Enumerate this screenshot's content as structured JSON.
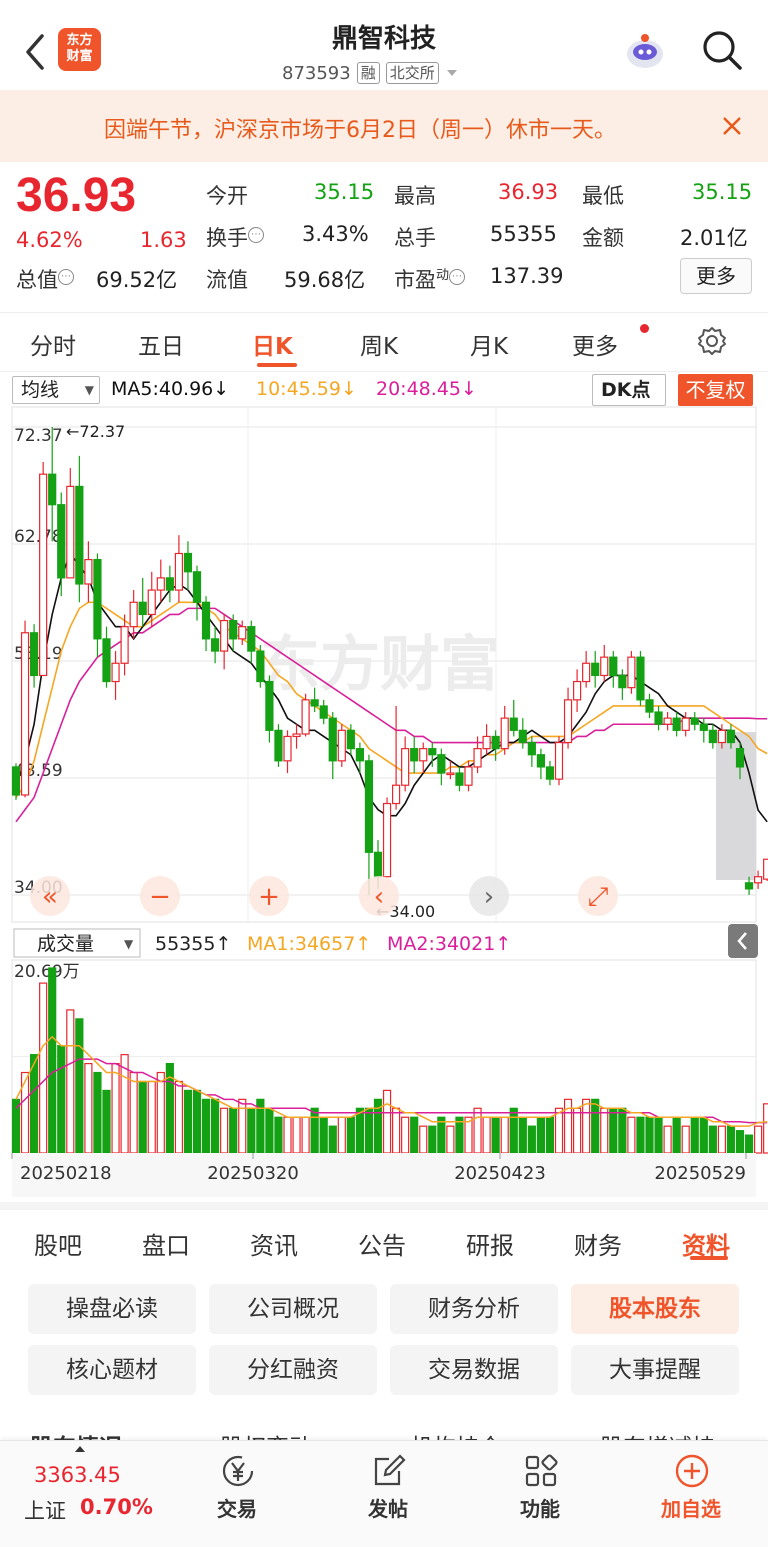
{
  "header": {
    "title": "鼎智科技",
    "code": "873593",
    "tags": [
      "融",
      "北交所"
    ],
    "logo_lines": [
      "东方",
      "财富"
    ]
  },
  "notice": {
    "text": "因端午节，沪深京市场于6月2日（周一）休市一天。"
  },
  "quote": {
    "price": "36.93",
    "change_pct": "4.62%",
    "change": "1.63",
    "open_label": "今开",
    "open": "35.15",
    "high_label": "最高",
    "high": "36.93",
    "low_label": "最低",
    "low": "35.15",
    "turnover_label": "换手",
    "turnover": "3.43%",
    "volume_label": "总手",
    "volume": "55355",
    "amount_label": "金额",
    "amount": "2.01亿",
    "mktcap_label": "总值",
    "mktcap": "69.52亿",
    "float_label": "流值",
    "float_cap": "59.68亿",
    "pe_label": "市盈",
    "pe_sup": "动",
    "pe": "137.39",
    "more": "更多"
  },
  "period_tabs": {
    "items": [
      "分时",
      "五日",
      "日K",
      "周K",
      "月K",
      "更多"
    ],
    "active": "日K"
  },
  "ma": {
    "selector": "均线",
    "ma5": "MA5:40.96↓",
    "ma10": "10:45.59↓",
    "ma20": "20:48.45↓",
    "dk": "DK点",
    "adjust": "不复权"
  },
  "vol": {
    "selector": "成交量",
    "value": "55355↑",
    "ma1": "MA1:34657↑",
    "ma2": "MA2:34021↑",
    "max_label": "20.69万"
  },
  "chart_data": {
    "type": "candlestick",
    "y_ticks": [
      "72.37",
      "62.78",
      "53.19",
      "43.59",
      "34.00"
    ],
    "ylim": [
      34.0,
      72.37
    ],
    "high_marker": "←72.37",
    "low_marker": "←34.00",
    "x_ticks": [
      "20250218",
      "20250320",
      "20250423",
      "20250529"
    ],
    "colors": {
      "up": "#e8262f",
      "down": "#14a114",
      "ma5": "#111111",
      "ma10": "#f5a623",
      "ma20": "#d91f9a"
    },
    "candles": [
      [
        44.5,
        42.2,
        44.8,
        41.8
      ],
      [
        42.2,
        55.5,
        56.5,
        42.0
      ],
      [
        55.5,
        52.0,
        56.2,
        51.0
      ],
      [
        52.0,
        68.5,
        69.5,
        52.0
      ],
      [
        68.5,
        66.0,
        72.37,
        63.0
      ],
      [
        66.0,
        60.0,
        67.0,
        58.5
      ],
      [
        60.0,
        67.5,
        69.0,
        60.0
      ],
      [
        67.5,
        59.5,
        70.0,
        58.0
      ],
      [
        59.5,
        61.5,
        63.0,
        58.0
      ],
      [
        61.5,
        55.0,
        62.0,
        53.5
      ],
      [
        55.0,
        51.5,
        56.0,
        51.0
      ],
      [
        51.5,
        53.0,
        54.0,
        50.0
      ],
      [
        53.0,
        56.0,
        57.0,
        52.0
      ],
      [
        56.0,
        58.0,
        59.0,
        55.0
      ],
      [
        58.0,
        57.0,
        60.0,
        56.0
      ],
      [
        57.0,
        59.0,
        60.5,
        56.0
      ],
      [
        59.0,
        60.0,
        61.5,
        58.0
      ],
      [
        60.0,
        59.0,
        61.0,
        58.0
      ],
      [
        59.0,
        62.0,
        63.5,
        58.0
      ],
      [
        62.0,
        60.5,
        63.0,
        59.0
      ],
      [
        60.5,
        58.0,
        61.0,
        56.5
      ],
      [
        58.0,
        55.0,
        58.5,
        54.0
      ],
      [
        55.0,
        54.0,
        56.0,
        53.0
      ],
      [
        54.0,
        56.5,
        57.0,
        52.5
      ],
      [
        56.5,
        55.0,
        57.0,
        54.0
      ],
      [
        55.0,
        56.0,
        56.5,
        54.5
      ],
      [
        56.0,
        54.0,
        56.5,
        53.0
      ],
      [
        54.0,
        51.5,
        54.5,
        51.0
      ],
      [
        51.5,
        47.5,
        52.0,
        46.5
      ],
      [
        47.5,
        45.0,
        48.0,
        44.5
      ],
      [
        45.0,
        47.0,
        47.5,
        44.0
      ],
      [
        47.0,
        47.2,
        48.0,
        46.0
      ],
      [
        47.2,
        50.0,
        50.5,
        47.0
      ],
      [
        50.0,
        49.5,
        51.0,
        49.0
      ],
      [
        49.5,
        48.5,
        50.0,
        48.0
      ],
      [
        48.5,
        45.0,
        49.0,
        43.5
      ],
      [
        45.0,
        47.5,
        48.0,
        44.5
      ],
      [
        47.5,
        46.0,
        48.0,
        45.5
      ],
      [
        46.0,
        45.0,
        46.5,
        44.0
      ],
      [
        45.0,
        37.5,
        45.5,
        34.0
      ],
      [
        37.5,
        35.5,
        38.5,
        34.5
      ],
      [
        35.5,
        41.5,
        42.0,
        35.5
      ],
      [
        41.5,
        43.0,
        49.5,
        41.0
      ],
      [
        43.0,
        46.0,
        47.0,
        42.5
      ],
      [
        46.0,
        45.0,
        47.0,
        44.0
      ],
      [
        45.0,
        46.0,
        46.5,
        44.0
      ],
      [
        46.0,
        45.5,
        46.5,
        44.5
      ],
      [
        45.5,
        44.0,
        46.0,
        43.0
      ],
      [
        44.0,
        44.0,
        45.0,
        43.5
      ],
      [
        44.0,
        43.0,
        44.5,
        42.5
      ],
      [
        43.0,
        44.5,
        45.0,
        42.5
      ],
      [
        44.5,
        46.0,
        47.0,
        44.0
      ],
      [
        46.0,
        47.0,
        48.0,
        45.5
      ],
      [
        47.0,
        46.0,
        47.5,
        45.0
      ],
      [
        46.0,
        48.5,
        49.5,
        45.5
      ],
      [
        48.5,
        47.5,
        50.0,
        47.0
      ],
      [
        47.5,
        46.5,
        48.5,
        46.0
      ],
      [
        46.5,
        45.5,
        47.0,
        44.5
      ],
      [
        45.5,
        44.5,
        46.0,
        43.5
      ],
      [
        44.5,
        43.5,
        45.0,
        43.0
      ],
      [
        43.5,
        46.5,
        47.0,
        43.0
      ],
      [
        46.5,
        50.0,
        51.0,
        46.0
      ],
      [
        50.0,
        51.5,
        52.5,
        49.0
      ],
      [
        51.5,
        53.0,
        54.0,
        51.0
      ],
      [
        53.0,
        52.0,
        54.0,
        51.0
      ],
      [
        52.0,
        53.5,
        54.5,
        51.5
      ],
      [
        53.5,
        52.0,
        54.0,
        51.0
      ],
      [
        52.0,
        51.0,
        52.5,
        50.0
      ],
      [
        51.0,
        53.5,
        54.0,
        50.5
      ],
      [
        53.5,
        50.0,
        54.0,
        49.5
      ],
      [
        50.0,
        49.0,
        50.5,
        48.5
      ],
      [
        49.0,
        48.0,
        49.5,
        47.5
      ],
      [
        48.0,
        48.5,
        49.0,
        47.5
      ],
      [
        48.5,
        47.5,
        49.0,
        47.0
      ],
      [
        47.5,
        48.5,
        49.0,
        47.0
      ],
      [
        48.5,
        48.0,
        49.0,
        47.5
      ],
      [
        48.0,
        47.5,
        48.5,
        46.5
      ],
      [
        47.5,
        46.5,
        48.0,
        46.0
      ],
      [
        46.5,
        47.5,
        48.0,
        46.0
      ],
      [
        47.5,
        46.5,
        48.0,
        46.0
      ],
      [
        46.0,
        44.5,
        46.5,
        43.5
      ],
      [
        35.0,
        34.5,
        35.5,
        34.0
      ],
      [
        35.0,
        35.5,
        36.0,
        34.5
      ],
      [
        35.3,
        36.93,
        36.93,
        35.15
      ]
    ],
    "ma5": [
      43,
      45,
      48,
      53,
      57,
      60,
      62,
      61,
      60,
      58,
      57,
      56,
      56,
      55,
      56,
      57,
      58,
      59,
      59.5,
      59,
      58,
      57,
      56,
      55,
      54,
      53.5,
      53,
      52,
      51,
      50,
      48.5,
      48,
      47.5,
      47.5,
      47,
      46.5,
      46,
      45.5,
      44,
      42,
      41,
      40.5,
      40.5,
      41.5,
      43,
      44,
      45,
      45.5,
      45,
      44.5,
      44.5,
      45,
      45.5,
      46,
      46.5,
      46.5,
      47,
      47.5,
      47,
      46.5,
      46.5,
      47,
      48,
      49,
      50.5,
      51.5,
      52,
      52,
      52,
      51.5,
      51,
      50.5,
      49.5,
      49,
      48.5,
      48.5,
      48,
      48,
      47.5,
      47.5,
      46.5,
      44,
      40.96,
      40
    ],
    "ma10": [
      42,
      43,
      45,
      48,
      51,
      54,
      56,
      57.5,
      58,
      58,
      57.5,
      57,
      56.5,
      56,
      56,
      56.5,
      57,
      57.5,
      58,
      58,
      58,
      57.5,
      57,
      56,
      55.5,
      55,
      54.5,
      54,
      53,
      52,
      51.5,
      50.5,
      50,
      49.5,
      49,
      48.5,
      48,
      47.5,
      47,
      46,
      45.5,
      45,
      44.5,
      44,
      44,
      44,
      44,
      44,
      44.5,
      44.5,
      45,
      45,
      45.5,
      45.5,
      46,
      46.5,
      46.5,
      47,
      47,
      47,
      47,
      47,
      47.5,
      48,
      48.5,
      49,
      49.5,
      49.5,
      49.5,
      49.5,
      49.5,
      49.5,
      49.5,
      49.5,
      49.5,
      49.5,
      49.5,
      49,
      48.5,
      48,
      47.5,
      47,
      46,
      45.59
    ],
    "ma20": [
      40,
      41,
      42,
      44,
      46,
      48,
      50,
      51.5,
      52.5,
      53.5,
      54,
      54.5,
      55,
      55.5,
      55.5,
      56,
      56.5,
      57,
      57,
      57.5,
      57.5,
      57.5,
      57.5,
      57,
      56.5,
      56,
      55.5,
      55,
      54.5,
      54,
      53.5,
      53,
      52.5,
      52,
      51.5,
      51,
      50.5,
      50,
      49.5,
      49,
      48.5,
      48,
      47.5,
      47.5,
      47,
      47,
      46.5,
      46.5,
      46.5,
      46.5,
      46.5,
      46.5,
      46.5,
      46.5,
      46.5,
      46.5,
      46.5,
      46.5,
      46.5,
      46.5,
      46.5,
      46.5,
      47,
      47,
      47.5,
      47.5,
      48,
      48,
      48,
      48,
      48,
      48,
      48,
      48,
      48.5,
      48.5,
      48.5,
      48.5,
      48.5,
      48.5,
      48.5,
      48.5,
      48.45,
      48.45
    ],
    "volume": [
      6,
      9,
      11,
      19,
      20.69,
      12,
      16,
      15,
      10,
      9,
      7,
      10,
      11,
      9,
      8,
      8,
      9,
      10,
      8,
      7,
      7,
      6,
      6,
      5,
      5,
      6,
      5,
      6,
      5,
      4,
      4,
      4,
      4,
      5,
      4,
      3,
      4,
      4,
      5,
      5,
      6,
      7,
      5,
      4,
      4,
      3,
      3,
      4,
      3,
      4,
      4,
      5,
      4,
      4,
      4,
      5,
      4,
      3,
      4,
      4,
      5,
      6,
      5,
      6,
      6,
      5,
      5,
      5,
      4,
      4,
      4,
      4,
      3,
      4,
      3,
      4,
      4,
      3,
      3,
      3,
      2.5,
      2,
      3,
      5.5
    ],
    "vol_ma1": [
      6,
      8,
      10,
      12,
      13,
      12,
      12,
      12,
      11,
      10,
      9,
      9,
      8.5,
      8,
      8,
      8,
      8,
      8.5,
      8,
      7.5,
      7,
      6.5,
      6,
      5.5,
      5,
      5,
      5,
      5,
      5,
      4.5,
      4,
      4,
      4,
      4,
      4,
      4,
      4,
      4,
      4.5,
      5,
      5,
      5.5,
      5,
      4.5,
      4.5,
      4,
      3.5,
      3.5,
      3.5,
      3.5,
      3.5,
      4,
      4,
      4,
      4,
      4,
      4,
      4,
      4,
      4,
      4.5,
      5,
      5,
      5.5,
      5.5,
      5,
      5,
      5,
      4.5,
      4.5,
      4,
      4,
      4,
      4,
      4,
      4,
      4,
      3.5,
      3.5,
      3,
      3,
      3,
      3.4,
      3.5
    ],
    "vol_ma2": [
      5,
      6,
      7,
      8,
      9,
      9.5,
      10,
      10.5,
      10.5,
      10.5,
      10,
      10,
      9.5,
      9,
      9,
      8.5,
      8,
      8,
      7.5,
      7.5,
      7,
      6.5,
      6.5,
      6,
      6,
      5.5,
      5.5,
      5,
      5,
      5,
      5,
      5,
      5,
      4.5,
      4.5,
      4.5,
      4.5,
      4.5,
      4.5,
      4.5,
      4.5,
      4.5,
      4.5,
      4.5,
      4.5,
      4.5,
      4.5,
      4.5,
      4.5,
      4.5,
      4.5,
      4.5,
      4.5,
      4.5,
      4.5,
      4.5,
      4.5,
      4.5,
      4.5,
      4.5,
      4.5,
      4.5,
      4.5,
      4.5,
      4.5,
      4.5,
      4.5,
      4.5,
      4.5,
      4.5,
      4.5,
      4,
      4,
      4,
      4,
      4,
      4,
      4,
      3.5,
      3.5,
      3.5,
      3.4,
      3.4,
      3.4
    ]
  },
  "bottom_tabs": {
    "items": [
      "股吧",
      "盘口",
      "资讯",
      "公告",
      "研报",
      "财务",
      "资料"
    ],
    "active": "资料"
  },
  "grid_buttons": [
    "操盘必读",
    "公司概况",
    "财务分析",
    "股本股东",
    "核心题材",
    "分红融资",
    "交易数据",
    "大事提醒"
  ],
  "grid_active": "股本股东",
  "sub_tabs": [
    "股东情况",
    "股权变动",
    "机构持仓",
    "股东增减持"
  ],
  "bottom_nav": {
    "index_value": "3363.45",
    "index_name": "上证",
    "index_change": "0.70%",
    "items": [
      "交易",
      "发帖",
      "功能",
      "加自选"
    ]
  }
}
